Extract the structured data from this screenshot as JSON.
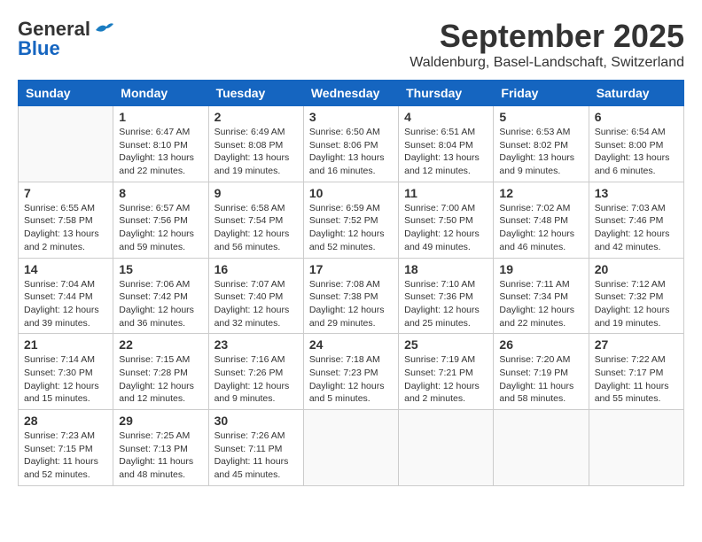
{
  "header": {
    "logo_general": "General",
    "logo_blue": "Blue",
    "title": "September 2025",
    "subtitle": "Waldenburg, Basel-Landschaft, Switzerland"
  },
  "calendar": {
    "days_of_week": [
      "Sunday",
      "Monday",
      "Tuesday",
      "Wednesday",
      "Thursday",
      "Friday",
      "Saturday"
    ],
    "weeks": [
      [
        {
          "day": "",
          "content": ""
        },
        {
          "day": "1",
          "content": "Sunrise: 6:47 AM\nSunset: 8:10 PM\nDaylight: 13 hours\nand 22 minutes."
        },
        {
          "day": "2",
          "content": "Sunrise: 6:49 AM\nSunset: 8:08 PM\nDaylight: 13 hours\nand 19 minutes."
        },
        {
          "day": "3",
          "content": "Sunrise: 6:50 AM\nSunset: 8:06 PM\nDaylight: 13 hours\nand 16 minutes."
        },
        {
          "day": "4",
          "content": "Sunrise: 6:51 AM\nSunset: 8:04 PM\nDaylight: 13 hours\nand 12 minutes."
        },
        {
          "day": "5",
          "content": "Sunrise: 6:53 AM\nSunset: 8:02 PM\nDaylight: 13 hours\nand 9 minutes."
        },
        {
          "day": "6",
          "content": "Sunrise: 6:54 AM\nSunset: 8:00 PM\nDaylight: 13 hours\nand 6 minutes."
        }
      ],
      [
        {
          "day": "7",
          "content": "Sunrise: 6:55 AM\nSunset: 7:58 PM\nDaylight: 13 hours\nand 2 minutes."
        },
        {
          "day": "8",
          "content": "Sunrise: 6:57 AM\nSunset: 7:56 PM\nDaylight: 12 hours\nand 59 minutes."
        },
        {
          "day": "9",
          "content": "Sunrise: 6:58 AM\nSunset: 7:54 PM\nDaylight: 12 hours\nand 56 minutes."
        },
        {
          "day": "10",
          "content": "Sunrise: 6:59 AM\nSunset: 7:52 PM\nDaylight: 12 hours\nand 52 minutes."
        },
        {
          "day": "11",
          "content": "Sunrise: 7:00 AM\nSunset: 7:50 PM\nDaylight: 12 hours\nand 49 minutes."
        },
        {
          "day": "12",
          "content": "Sunrise: 7:02 AM\nSunset: 7:48 PM\nDaylight: 12 hours\nand 46 minutes."
        },
        {
          "day": "13",
          "content": "Sunrise: 7:03 AM\nSunset: 7:46 PM\nDaylight: 12 hours\nand 42 minutes."
        }
      ],
      [
        {
          "day": "14",
          "content": "Sunrise: 7:04 AM\nSunset: 7:44 PM\nDaylight: 12 hours\nand 39 minutes."
        },
        {
          "day": "15",
          "content": "Sunrise: 7:06 AM\nSunset: 7:42 PM\nDaylight: 12 hours\nand 36 minutes."
        },
        {
          "day": "16",
          "content": "Sunrise: 7:07 AM\nSunset: 7:40 PM\nDaylight: 12 hours\nand 32 minutes."
        },
        {
          "day": "17",
          "content": "Sunrise: 7:08 AM\nSunset: 7:38 PM\nDaylight: 12 hours\nand 29 minutes."
        },
        {
          "day": "18",
          "content": "Sunrise: 7:10 AM\nSunset: 7:36 PM\nDaylight: 12 hours\nand 25 minutes."
        },
        {
          "day": "19",
          "content": "Sunrise: 7:11 AM\nSunset: 7:34 PM\nDaylight: 12 hours\nand 22 minutes."
        },
        {
          "day": "20",
          "content": "Sunrise: 7:12 AM\nSunset: 7:32 PM\nDaylight: 12 hours\nand 19 minutes."
        }
      ],
      [
        {
          "day": "21",
          "content": "Sunrise: 7:14 AM\nSunset: 7:30 PM\nDaylight: 12 hours\nand 15 minutes."
        },
        {
          "day": "22",
          "content": "Sunrise: 7:15 AM\nSunset: 7:28 PM\nDaylight: 12 hours\nand 12 minutes."
        },
        {
          "day": "23",
          "content": "Sunrise: 7:16 AM\nSunset: 7:26 PM\nDaylight: 12 hours\nand 9 minutes."
        },
        {
          "day": "24",
          "content": "Sunrise: 7:18 AM\nSunset: 7:23 PM\nDaylight: 12 hours\nand 5 minutes."
        },
        {
          "day": "25",
          "content": "Sunrise: 7:19 AM\nSunset: 7:21 PM\nDaylight: 12 hours\nand 2 minutes."
        },
        {
          "day": "26",
          "content": "Sunrise: 7:20 AM\nSunset: 7:19 PM\nDaylight: 11 hours\nand 58 minutes."
        },
        {
          "day": "27",
          "content": "Sunrise: 7:22 AM\nSunset: 7:17 PM\nDaylight: 11 hours\nand 55 minutes."
        }
      ],
      [
        {
          "day": "28",
          "content": "Sunrise: 7:23 AM\nSunset: 7:15 PM\nDaylight: 11 hours\nand 52 minutes."
        },
        {
          "day": "29",
          "content": "Sunrise: 7:25 AM\nSunset: 7:13 PM\nDaylight: 11 hours\nand 48 minutes."
        },
        {
          "day": "30",
          "content": "Sunrise: 7:26 AM\nSunset: 7:11 PM\nDaylight: 11 hours\nand 45 minutes."
        },
        {
          "day": "",
          "content": ""
        },
        {
          "day": "",
          "content": ""
        },
        {
          "day": "",
          "content": ""
        },
        {
          "day": "",
          "content": ""
        }
      ]
    ]
  }
}
